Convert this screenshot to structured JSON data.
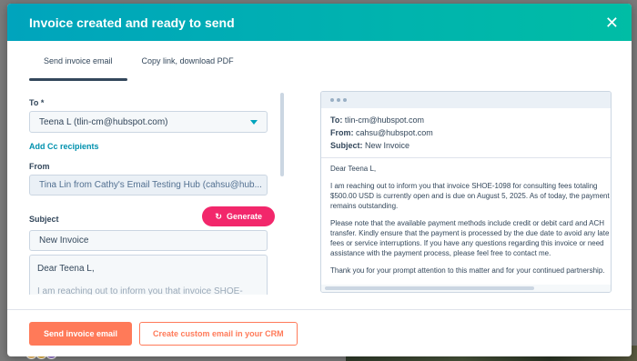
{
  "modal": {
    "title": "Invoice created and ready to send",
    "close_glyph": "✕"
  },
  "tabs": [
    {
      "label": "Send invoice email",
      "active": true
    },
    {
      "label": "Copy link, download PDF",
      "active": false
    }
  ],
  "form": {
    "to_label": "To *",
    "to_value": "Teena L (tlin-cm@hubspot.com)",
    "add_cc_label": "Add Cc recipients",
    "from_label": "From",
    "from_value": "Tina Lin from Cathy's Email Testing Hub (cahsu@hub...",
    "subject_label": "Subject",
    "generate_label": "Generate",
    "subject_value": "New Invoice",
    "body_line1": "Dear Teena L,",
    "body_line2": "I am reaching out to inform you that invoice SHOE-"
  },
  "preview": {
    "to_label": "To:",
    "to_value": "tlin-cm@hubspot.com",
    "from_label": "From:",
    "from_value": "cahsu@hubspot.com",
    "subject_label": "Subject:",
    "subject_value": "New Invoice",
    "greeting": "Dear Teena L,",
    "para1": "I am reaching out to inform you that invoice SHOE-1098 for consulting fees totaling $500.00 USD is currently open and is due on August 5, 2025. As of today, the payment remains outstanding.",
    "para2": "Please note that the available payment methods include credit or debit card and ACH transfer. Kindly ensure that the payment is processed by the due date to avoid any late fees or service interruptions. If you have any questions regarding this invoice or need assistance with the payment process, please feel free to contact me.",
    "para3": "Thank you for your prompt attention to this matter and for your continued partnership."
  },
  "footer": {
    "send_label": "Send invoice email",
    "crm_label": "Create custom email in your CRM"
  },
  "colors": {
    "header_start": "#00a4bd",
    "header_end": "#00bda5",
    "primary": "#ff7a59",
    "generate": "#f2276b",
    "link": "#0091ae"
  },
  "icons": {
    "close": "close-icon",
    "dropdown": "chevron-down-icon",
    "generate": "refresh-icon"
  }
}
